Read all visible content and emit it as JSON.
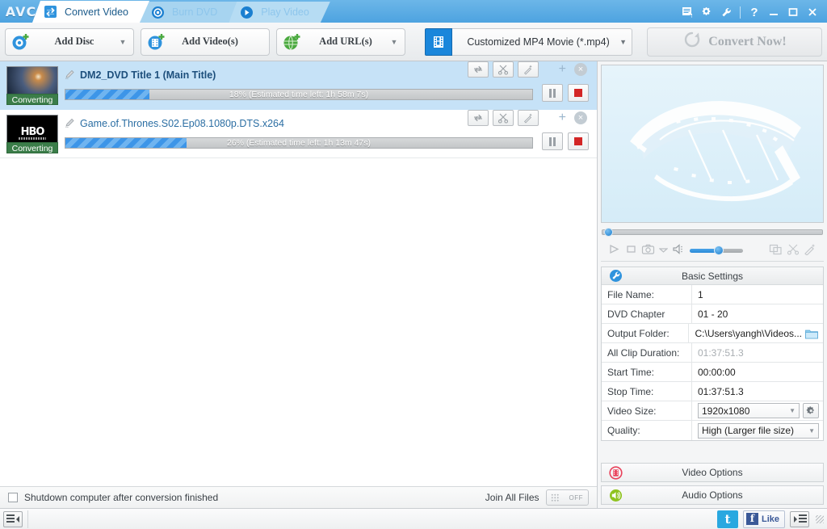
{
  "titlebar": {
    "logo": "AVC",
    "tabs": [
      {
        "label": "Convert Video",
        "icon": "convert-icon",
        "active": true
      },
      {
        "label": "Burn DVD",
        "icon": "disc-icon",
        "active": false
      },
      {
        "label": "Play Video",
        "icon": "play-icon",
        "active": false
      }
    ],
    "buttons": {
      "list": "list-icon",
      "settings": "gear-icon",
      "tools": "wrench-icon",
      "help": "?",
      "minimize": "minimize-icon",
      "maximize": "maximize-icon",
      "close": "close-icon"
    }
  },
  "toolbar": {
    "add_disc": "Add Disc",
    "add_videos": "Add Video(s)",
    "add_urls": "Add URL(s)",
    "profile": "Customized MP4 Movie (*.mp4)",
    "convert_now": "Convert Now!"
  },
  "list": {
    "rows": [
      {
        "title": "DM2_DVD Title 1 (Main Title)",
        "status": "Converting",
        "progress": 18,
        "progress_text": "18% (Estimated time left: 1h 58m 7s)",
        "thumb": "space-thumbnail",
        "selected": true
      },
      {
        "title": "Game.of.Thrones.S02.Ep08.1080p.DTS.x264",
        "status": "Converting",
        "progress": 26,
        "progress_text": "26% (Estimated time left: 1h 13m 47s)",
        "thumb": "hbo-thumbnail",
        "thumb_text": "HBO",
        "selected": false
      }
    ],
    "row_tools": [
      "convert-icon",
      "scissors-icon",
      "wand-icon"
    ],
    "row_add": "+",
    "row_delete": "×"
  },
  "bottom_options": {
    "shutdown_label": "Shutdown computer after conversion finished",
    "shutdown_checked": false,
    "join_label": "Join All Files",
    "join_state": "OFF"
  },
  "preview": {
    "watermark": "filmstrip-watermark",
    "controls": [
      "play-icon",
      "stop-icon",
      "camera-icon",
      "chevron-down-icon",
      "volume-icon",
      "clone-icon",
      "scissors-icon",
      "wand-icon"
    ],
    "volume_percent": 50,
    "seek_percent": 1
  },
  "settings": {
    "header": "Basic Settings",
    "header_icon": "wrench-icon",
    "rows": [
      {
        "key": "File Name:",
        "value": "1",
        "type": "text"
      },
      {
        "key": "DVD Chapter",
        "value": "01  -  20",
        "type": "text"
      },
      {
        "key": "Output Folder:",
        "value": "C:\\Users\\yangh\\Videos...",
        "type": "folder"
      },
      {
        "key": "All Clip Duration:",
        "value": "01:37:51.3",
        "type": "dim"
      },
      {
        "key": "Start Time:",
        "value": "00:00:00",
        "type": "text"
      },
      {
        "key": "Stop Time:",
        "value": "01:37:51.3",
        "type": "text"
      },
      {
        "key": "Video Size:",
        "value": "1920x1080",
        "type": "select-gear"
      },
      {
        "key": "Quality:",
        "value": "High (Larger file size)",
        "type": "select"
      }
    ]
  },
  "options": [
    {
      "label": "Video Options",
      "icon": "video-options-icon",
      "color": "#e8415a"
    },
    {
      "label": "Audio Options",
      "icon": "audio-options-icon",
      "color": "#8fc31f"
    }
  ],
  "statusbar": {
    "left_toggle": "collapse-panel-icon",
    "twitter": "t",
    "facebook_icon": "f",
    "facebook_label": "Like",
    "right_toggle": "expand-panel-icon"
  },
  "colors": {
    "accent": "#3d95e8",
    "titlebar": "#4da3e0",
    "status_badge": "#3b7d49",
    "stop_red": "#d32626"
  }
}
